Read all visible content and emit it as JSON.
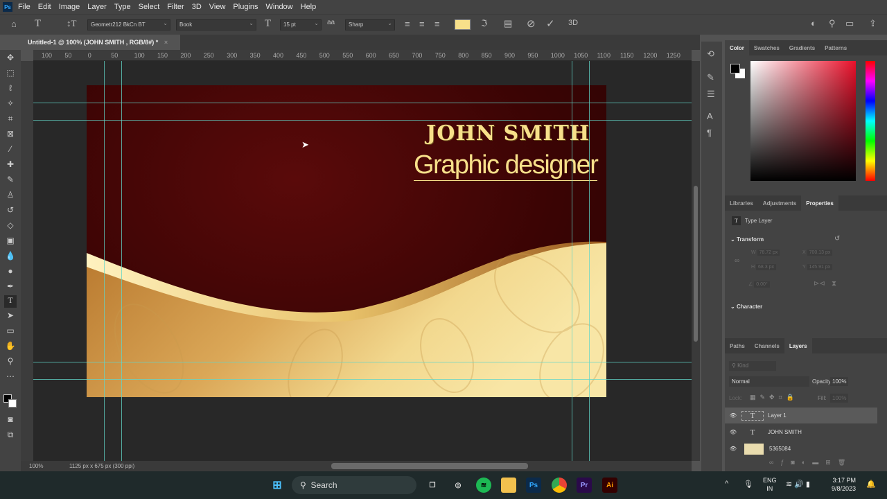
{
  "menu": [
    "File",
    "Edit",
    "Image",
    "Layer",
    "Type",
    "Select",
    "Filter",
    "3D",
    "View",
    "Plugins",
    "Window",
    "Help"
  ],
  "options": {
    "font_family": "Geometr212 BkCn BT",
    "font_style": "Book",
    "font_size": "15 pt",
    "antialias": "Sharp",
    "text_color": "#f7e08a"
  },
  "document_tab": "Untitled-1 @ 100% (JOHN  SMITH , RGB/8#) *",
  "ruler_top": [
    "100",
    "50",
    "0",
    "50",
    "100",
    "150",
    "200",
    "250",
    "300",
    "350",
    "400",
    "450",
    "500",
    "550",
    "600",
    "650",
    "700",
    "750",
    "800",
    "850",
    "900",
    "950",
    "1000",
    "1050",
    "1100",
    "1150",
    "1200",
    "1250"
  ],
  "card": {
    "name": "JOHN  SMITH",
    "title": "Graphic designer"
  },
  "status": {
    "zoom": "100%",
    "doc_info": "1125 px x 675 px (300 ppi)"
  },
  "color_panel": {
    "tabs": [
      "Color",
      "Swatches",
      "Gradients",
      "Patterns"
    ],
    "active": "Color"
  },
  "properties_panel": {
    "tabs": [
      "Libraries",
      "Adjustments",
      "Properties"
    ],
    "active": "Properties",
    "layer_kind": "Type Layer",
    "transform_label": "Transform",
    "w": "78.72 px",
    "x": "700.13 px",
    "h": "68.3 px",
    "y": "145.91 px",
    "angle": "0.00°",
    "character_label": "Character"
  },
  "layers_panel": {
    "tabs": [
      "Paths",
      "Channels",
      "Layers"
    ],
    "active": "Layers",
    "kind_placeholder": "Kind",
    "blend_mode": "Normal",
    "opacity_label": "Opacity:",
    "opacity": "100%",
    "lock_label": "Lock:",
    "fill_label": "Fill:",
    "fill": "100%",
    "layers": [
      {
        "name": "Layer 1",
        "type": "text",
        "selected": true
      },
      {
        "name": "JOHN  SMITH",
        "type": "text",
        "selected": false
      },
      {
        "name": "5365084",
        "type": "image",
        "selected": false
      }
    ]
  },
  "taskbar": {
    "search": "Search",
    "lang1": "ENG",
    "lang2": "IN",
    "time": "3:17 PM",
    "date": "9/8/2023"
  }
}
